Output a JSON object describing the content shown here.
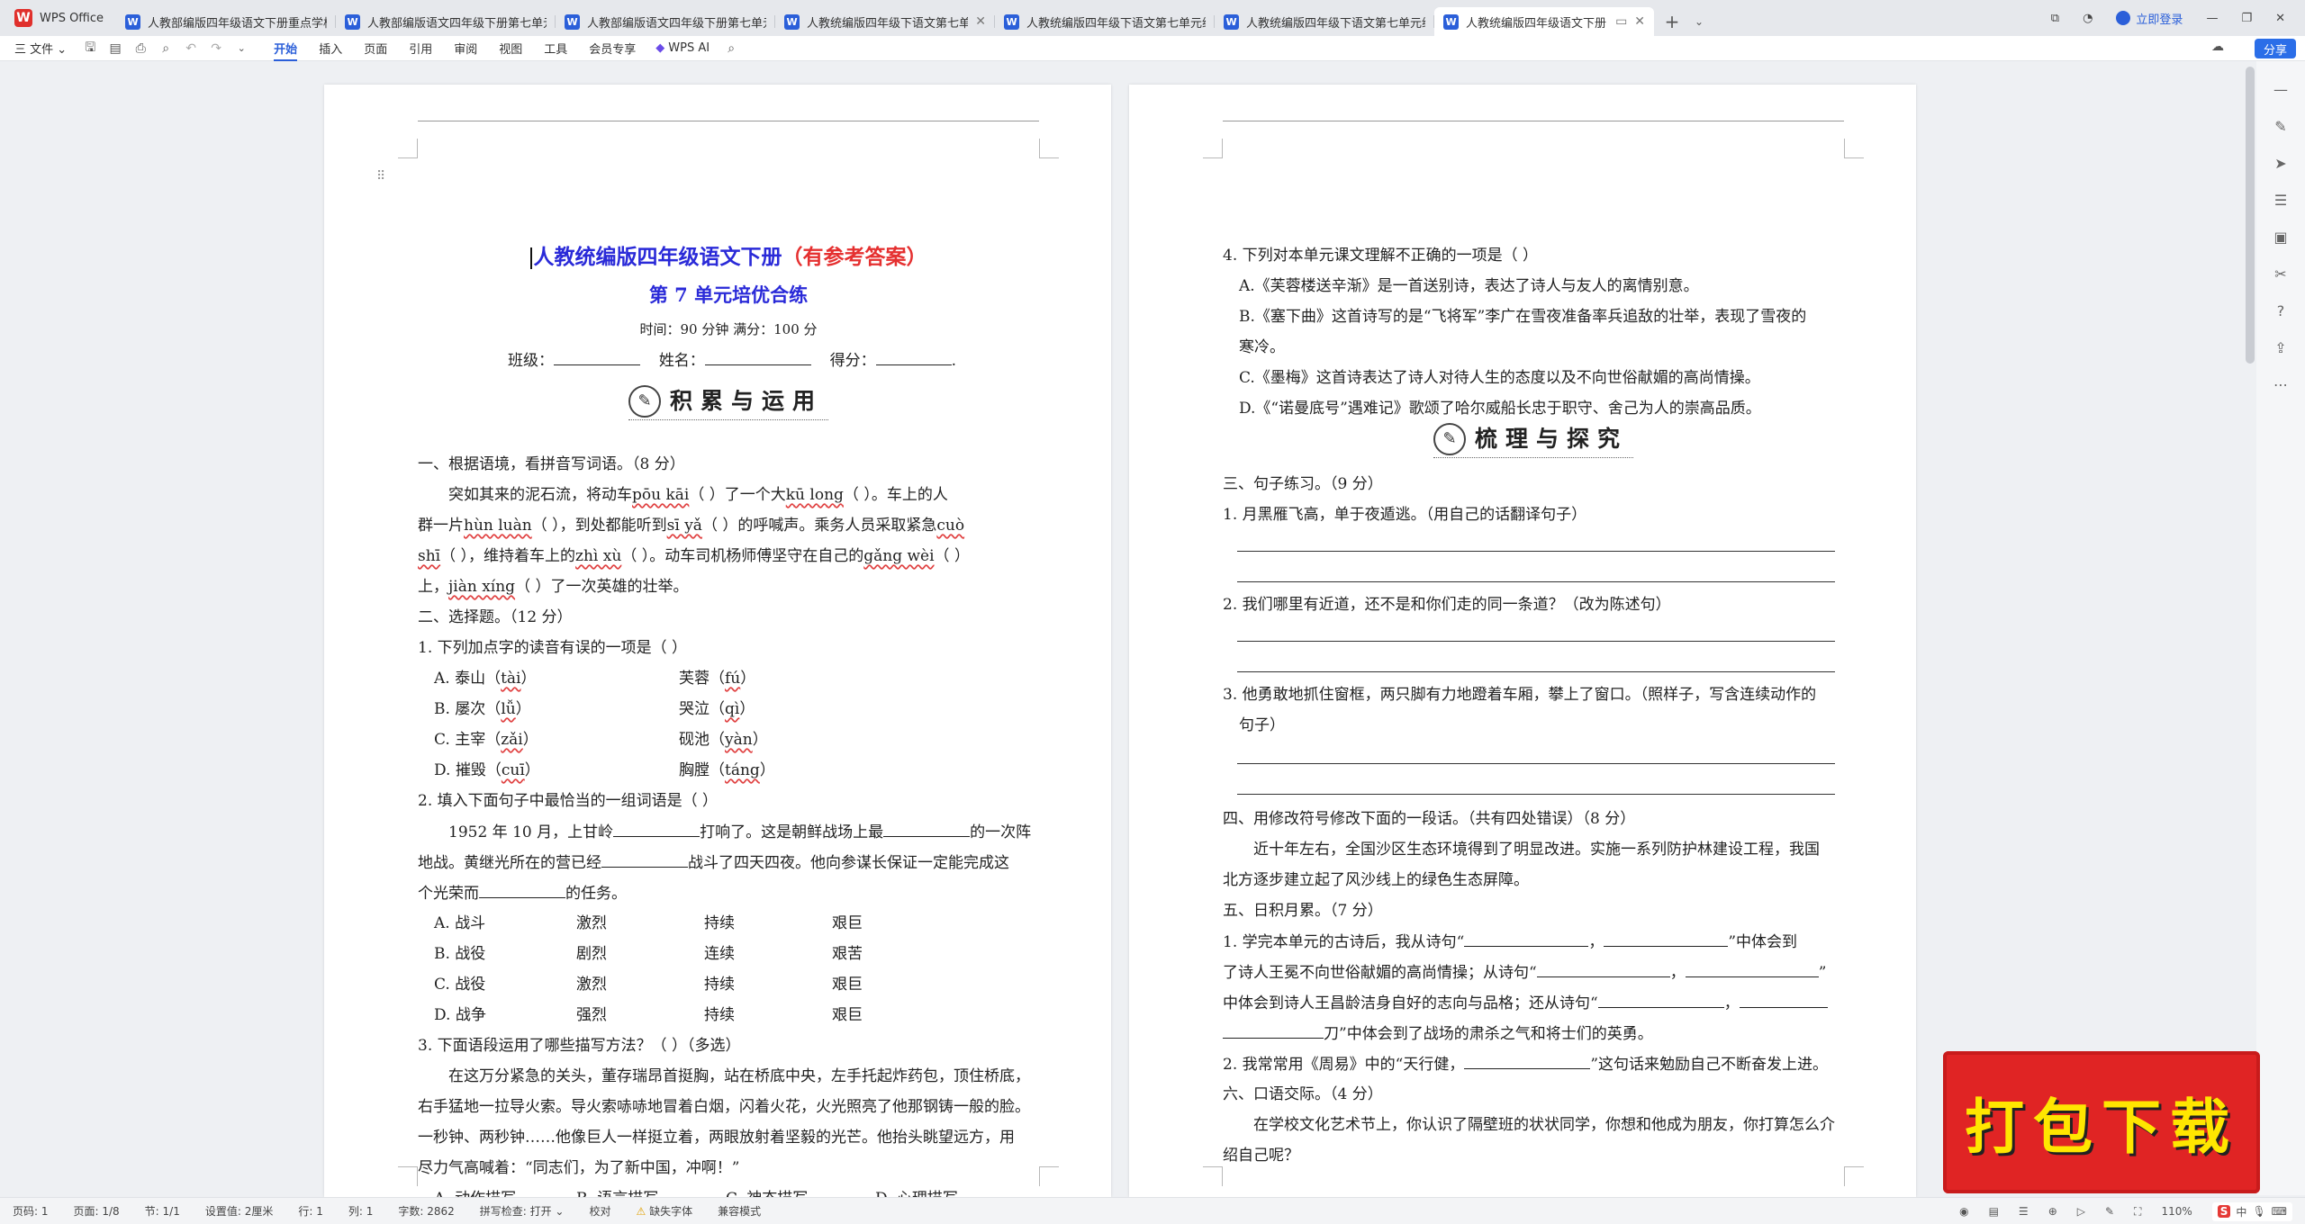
{
  "tabbar": {
    "home_label": "WPS Office",
    "tabs": [
      {
        "title": "人教部编版四年级语文下册重点学校",
        "active": false
      },
      {
        "title": "人教部编版语文四年级下册第七单元",
        "active": false
      },
      {
        "title": "人教部编版语文四年级下册第七单元",
        "active": false
      },
      {
        "title": "人教统编版四年级下语文第七单元",
        "active": false
      },
      {
        "title": "人教统编版四年级下语文第七单元综",
        "active": false
      },
      {
        "title": "人教统编版四年级下语文第七单元综",
        "active": false
      },
      {
        "title": "人教统编版四年级语文下册 第",
        "active": true
      }
    ],
    "login_label": "立即登录"
  },
  "menubar": {
    "file_label": "三 文件 ⌄",
    "items": [
      "开始",
      "插入",
      "页面",
      "引用",
      "审阅",
      "视图",
      "工具",
      "会员专享"
    ],
    "active_item": "开始",
    "ai_label": "WPS AI",
    "share_label": "分享"
  },
  "page1": {
    "title_main": "人教统编版四年级语文下册",
    "title_note": "（有参考答案）",
    "subtitle": "第 7 单元培优合练",
    "time_info": "时间：90 分钟  满分：100 分",
    "class_label": "班级：",
    "name_label": "姓名：",
    "score_label": "得分：",
    "section1": "积累与运用",
    "q1_title": "一、根据语境，看拼音写词语。（8 分）",
    "q1_l1a": "突如其来的泥石流，将动车",
    "q1_py1": "pōu kāi",
    "q1_l1b": "（      ）了一个大",
    "q1_py2": "kū long",
    "q1_l1c": "（      ）。车上的人",
    "q1_l2a": "群一片",
    "q1_py3": "hùn luàn",
    "q1_l2b": "（      ），到处都能听到",
    "q1_py4": "sī yǎ",
    "q1_l2c": "（      ）的呼喊声。乘务人员采取紧急",
    "q1_py5": "cuò",
    "q1_l3a": "shī",
    "q1_l3b": "（      ），维持着车上的",
    "q1_py6": "zhì xù",
    "q1_l3c": "（      ）。动车司机杨师傅坚守在自己的",
    "q1_py7": "gǎng wèi",
    "q1_l3d": "（      ）",
    "q1_l4a": "上，",
    "q1_py8": "jiàn xíng",
    "q1_l4b": "（      ）了一次英雄的壮举。",
    "q2_title": "二、选择题。（12 分）",
    "q2_1": "1. 下列加点字的读音有误的一项是（      ）",
    "q2_1_opts": [
      [
        "A. 泰山（",
        "tài",
        "）",
        "芙蓉（",
        "fú",
        "）"
      ],
      [
        "B. 屡次（",
        "lǚ",
        "）",
        "哭泣（",
        "qì",
        "）"
      ],
      [
        "C. 主宰（",
        "zǎi",
        "）",
        "砚池（",
        "yàn",
        "）"
      ],
      [
        "D. 摧毁（",
        "cuī",
        "）",
        "胸膛（",
        "táng",
        "）"
      ]
    ],
    "q2_2": "2. 填入下面句子中最恰当的一组词语是（      ）",
    "q2_2_l1a": "1952 年 10 月，上甘岭",
    "q2_2_l1b": "打响了。这是朝鲜战场上最",
    "q2_2_l1c": "的一次阵",
    "q2_2_l2a": "地战。黄继光所在的营已经",
    "q2_2_l2b": "战斗了四天四夜。他向参谋长保证一定能完成这",
    "q2_2_l3a": "个光荣而",
    "q2_2_l3b": "的任务。",
    "q2_2_opts": [
      [
        "A. 战斗",
        "激烈",
        "持续",
        "艰巨"
      ],
      [
        "B. 战役",
        "剧烈",
        "连续",
        "艰苦"
      ],
      [
        "C. 战役",
        "激烈",
        "持续",
        "艰巨"
      ],
      [
        "D. 战争",
        "强烈",
        "持续",
        "艰巨"
      ]
    ],
    "q2_3": "3. 下面语段运用了哪些描写方法？（      ）（多选）",
    "q2_3_p": [
      "在这万分紧急的关头，董存瑞昂首挺胸，站在桥底中央，左手托起炸药包，顶住桥底，",
      "右手猛地一拉导火索。导火索哧哧地冒着白烟，闪着火花，火光照亮了他那钢铸一般的脸。",
      "一秒钟、两秒钟……他像巨人一样挺立着，两眼放射着坚毅的光芒。他抬头眺望远方，用",
      "尽力气高喊着：“同志们，为了新中国，冲啊！”"
    ],
    "q2_3_opts": [
      "A. 动作描写",
      "B. 语言描写",
      "C. 神态描写",
      "D. 心理描写"
    ]
  },
  "page2": {
    "q4": "4. 下列对本单元课文理解不正确的一项是（      ）",
    "q4_a": "A.《芙蓉楼送辛渐》是一首送别诗，表达了诗人与友人的离情别意。",
    "q4_b1": "B.《塞下曲》这首诗写的是“飞将军”李广在雪夜准备率兵追敌的壮举，表现了雪夜的",
    "q4_b2": "寒冷。",
    "q4_c": "C.《墨梅》这首诗表达了诗人对待人生的态度以及不向世俗献媚的高尚情操。",
    "q4_d": "D.《“诺曼底号”遇难记》歌颂了哈尔威船长忠于职守、舍己为人的崇高品质。",
    "section2": "梳理与探究",
    "s3_title": "三、句子练习。（9 分）",
    "s3_1": "1. 月黑雁飞高，单于夜遁逃。（用自己的话翻译句子）",
    "s3_2": "2. 我们哪里有近道，还不是和你们走的同一条道？（改为陈述句）",
    "s3_3a": "3. 他勇敢地抓住窗框，两只脚有力地蹬着车厢，攀上了窗口。（照样子，写含连续动作的",
    "s3_3b": "句子）",
    "s4_title": "四、用修改符号修改下面的一段话。（共有四处错误）（8 分）",
    "s4_p1": "近十年左右，全国沙区生态环境得到了明显改进。实施一系列防护林建设工程，我国",
    "s4_p2": "北方逐步建立起了风沙线上的绿色生态屏障。",
    "s5_title": "五、日积月累。（7 分）",
    "s5_1a": "1. 学完本单元的古诗后，我从诗句“",
    "s5_1b": "，",
    "s5_1c": "”中体会到",
    "s5_2a": "了诗人王冕不向世俗献媚的高尚情操；从诗句“",
    "s5_2b": "，",
    "s5_2c": "”",
    "s5_3a": "中体会到诗人王昌龄洁身自好的志向与品格；还从诗句“",
    "s5_3b": "，",
    "s5_4a": "刀”中体会到了战场的肃杀之气和将士们的英勇。",
    "s5_5a": "2. 我常常用《周易》中的“天行健，",
    "s5_5b": "”这句话来勉励自己不断奋发上进。",
    "s6_title": "六、口语交际。（4 分）",
    "s6_p1": "在学校文化艺术节上，你认识了隔壁班的状状同学，你想和他成为朋友，你打算怎么介",
    "s6_p2": "绍自己呢？"
  },
  "statusbar": {
    "page_num": "页码: 1",
    "pages": "页面: 1/8",
    "section": "节: 1/1",
    "setting": "设置值: 2厘米",
    "row": "行: 1",
    "col": "列: 1",
    "words": "字数: 2862",
    "spell": "拼写检查: 打开 ⌄",
    "proof": "校对",
    "missing_font": "缺失字体",
    "compat": "兼容模式",
    "zoom": "110%"
  },
  "download_banner": "打包下载",
  "colors": {
    "accent": "#2b5fd9",
    "title_blue": "#2a2ad8",
    "title_red": "#e53030",
    "banner_red": "#e02424",
    "banner_text": "#ffe600"
  }
}
